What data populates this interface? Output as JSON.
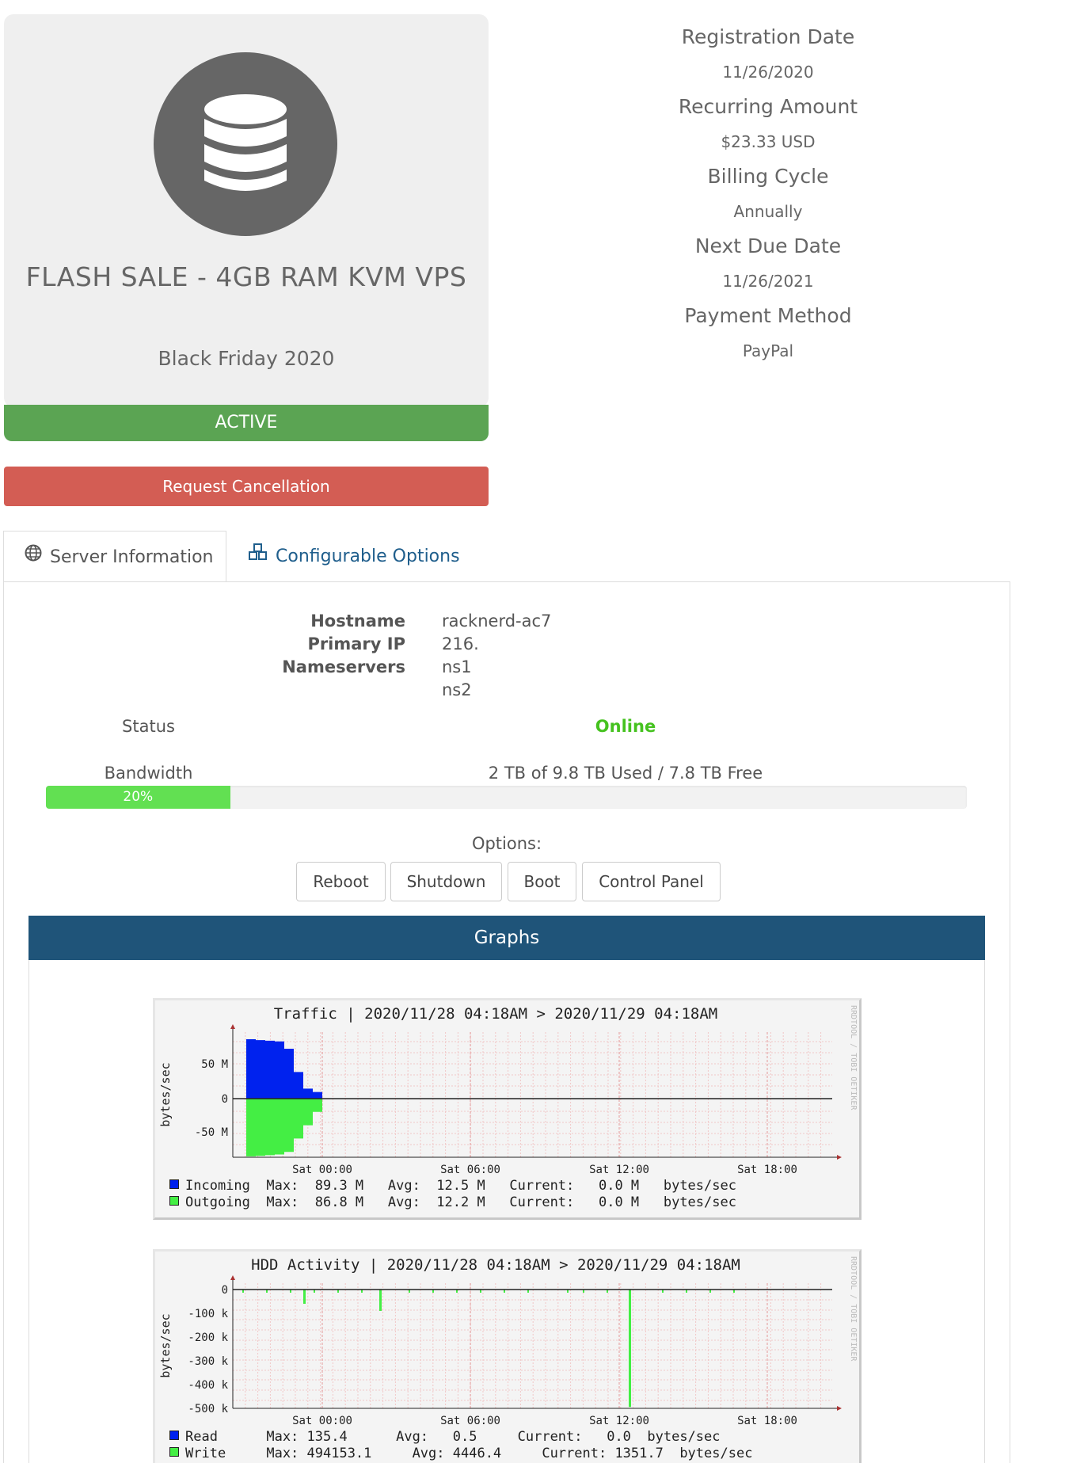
{
  "product": {
    "name": "FLASH SALE - 4GB RAM KVM VPS",
    "group": "Black Friday 2020",
    "status": "ACTIVE",
    "icon": "database-icon",
    "cancel_label": "Request Cancellation"
  },
  "billing": {
    "registration_label": "Registration Date",
    "registration_value": "11/26/2020",
    "recurring_label": "Recurring Amount",
    "recurring_value": "$23.33 USD",
    "cycle_label": "Billing Cycle",
    "cycle_value": "Annually",
    "due_label": "Next Due Date",
    "due_value": "11/26/2021",
    "payment_label": "Payment Method",
    "payment_value": "PayPal"
  },
  "tabs": {
    "server_info": "Server Information",
    "config_options": "Configurable Options"
  },
  "server": {
    "hostname_label": "Hostname",
    "hostname_value": "racknerd-ac7",
    "ip_label": "Primary IP",
    "ip_value": "216.",
    "ns_label": "Nameservers",
    "ns1": "ns1",
    "ns2": "ns2",
    "status_label": "Status",
    "status_value": "Online",
    "bandwidth_label": "Bandwidth",
    "bandwidth_value": "2 TB of 9.8 TB Used / 7.8 TB Free",
    "bandwidth_percent_label": "20%",
    "bandwidth_fraction": 0.2
  },
  "options": {
    "label": "Options:",
    "reboot": "Reboot",
    "shutdown": "Shutdown",
    "boot": "Boot",
    "control_panel": "Control Panel"
  },
  "graphs": {
    "header": "Graphs",
    "side_text": "RRDTOOL / TOBI OETIKER",
    "traffic": {
      "title": "Traffic | 2020/11/28 04:18AM > 2020/11/29 04:18AM",
      "legend_in": "Incoming  Max:  89.3 M   Avg:  12.5 M   Current:   0.0 M   bytes/sec",
      "legend_out": "Outgoing  Max:  86.8 M   Avg:  12.2 M   Current:   0.0 M   bytes/sec"
    },
    "hdd": {
      "title": "HDD Activity | 2020/11/28 04:18AM > 2020/11/29 04:18AM",
      "legend_read": "Read      Max: 135.4      Avg:   0.5     Current:   0.0  bytes/sec",
      "legend_write": "Write     Max: 494153.1     Avg: 4446.4     Current: 1351.7  bytes/sec"
    }
  },
  "colors": {
    "active_green": "#5ba453",
    "cancel_red": "#d35d54",
    "online_green": "#45c21f",
    "header_blue": "#1f5479",
    "incoming": "#0022ee",
    "outgoing": "#44ee44"
  },
  "chart_data": [
    {
      "type": "area",
      "title": "Traffic | 2020/11/28 04:18AM > 2020/11/29 04:18AM",
      "ylabel": "bytes/sec",
      "x_tick_labels": [
        "Sat 00:00",
        "Sat 06:00",
        "Sat 12:00",
        "Sat 18:00"
      ],
      "y_tick_labels": [
        "50 M",
        "0",
        "-50 M"
      ],
      "series": [
        {
          "name": "Incoming",
          "values": [
            89.3,
            88,
            87,
            86,
            75,
            40,
            15,
            10,
            0
          ]
        },
        {
          "name": "Outgoing",
          "values": [
            -86.8,
            -86,
            -85,
            -84,
            -80,
            -60,
            -40,
            -20,
            0
          ]
        }
      ],
      "grid": true
    },
    {
      "type": "bar",
      "title": "HDD Activity | 2020/11/28 04:18AM > 2020/11/29 04:18AM",
      "ylabel": "bytes/sec",
      "x_tick_labels": [
        "Sat 00:00",
        "Sat 06:00",
        "Sat 12:00",
        "Sat 18:00"
      ],
      "y_tick_labels": [
        "0",
        "-100 k",
        "-200 k",
        "-300 k",
        "-400 k",
        "-500 k"
      ],
      "series": [
        {
          "name": "Write",
          "spikes": [
            {
              "x": "Sat 00:00",
              "value": -60000
            },
            {
              "x": "Sat 06:00",
              "value": -90000
            },
            {
              "x": "Sat 12:00",
              "value": -494153
            }
          ]
        }
      ],
      "grid": true
    }
  ]
}
